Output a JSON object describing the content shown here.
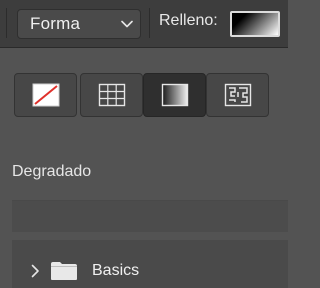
{
  "toolbar": {
    "type_select": {
      "value": "Forma"
    },
    "fill_label": "Relleno:",
    "fill_swatch": {
      "type": "gradient",
      "from": "#000000",
      "to": "#ffffff"
    }
  },
  "fill_types": [
    {
      "name": "no-fill",
      "icon": "no-fill-icon",
      "active": false
    },
    {
      "name": "solid-color",
      "icon": "solid-color-grid-icon",
      "active": false
    },
    {
      "name": "gradient",
      "icon": "gradient-icon",
      "active": true
    },
    {
      "name": "pattern",
      "icon": "pattern-icon",
      "active": false
    }
  ],
  "section": {
    "title": "Degradado"
  },
  "list": {
    "folders": [
      {
        "label": "Basics",
        "expanded": false
      }
    ]
  },
  "colors": {
    "panel_bg": "#535353",
    "toolbar_bg": "#3d3d3d",
    "no_fill_slash": "#e0302b"
  }
}
